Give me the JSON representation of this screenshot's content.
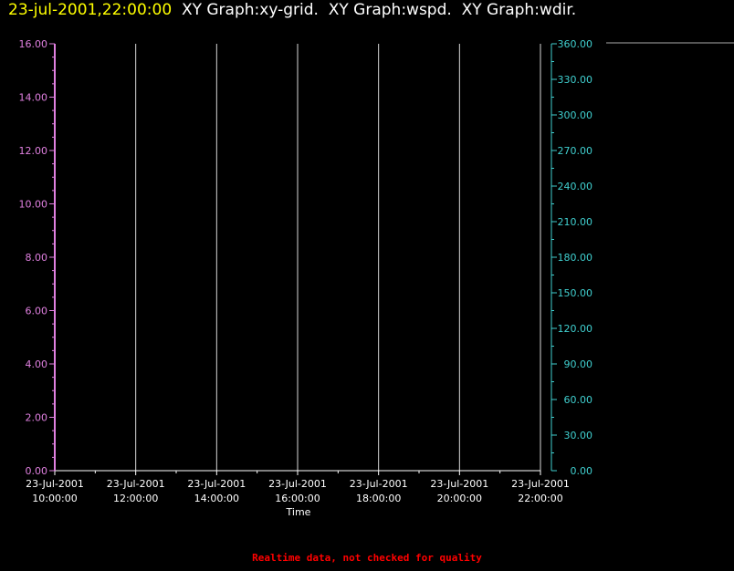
{
  "header": {
    "timestamp": "23-jul-2001,22:00:00",
    "graph_titles": [
      "XY Graph:xy-grid.",
      "XY Graph:wspd.",
      "XY Graph:wdir."
    ]
  },
  "colors": {
    "background": "#000000",
    "timestamp": "#ffff00",
    "titles": "#ffffff",
    "left_axis": "#e080e0",
    "right_axis": "#40d0d0",
    "grid": "#ffffff",
    "footer": "#ff0000"
  },
  "chart_data": {
    "type": "line",
    "grid": true,
    "xlabel": "Time",
    "x_ticks": [
      {
        "date": "23-Jul-2001",
        "time": "10:00:00"
      },
      {
        "date": "23-Jul-2001",
        "time": "12:00:00"
      },
      {
        "date": "23-Jul-2001",
        "time": "14:00:00"
      },
      {
        "date": "23-Jul-2001",
        "time": "16:00:00"
      },
      {
        "date": "23-Jul-2001",
        "time": "18:00:00"
      },
      {
        "date": "23-Jul-2001",
        "time": "20:00:00"
      },
      {
        "date": "23-Jul-2001",
        "time": "22:00:00"
      }
    ],
    "xlim": [
      "23-Jul-2001 10:00:00",
      "23-Jul-2001 22:00:00"
    ],
    "left_axis": {
      "ylim": [
        0,
        16
      ],
      "tick_labels": [
        "0.00",
        "2.00",
        "4.00",
        "6.00",
        "8.00",
        "10.00",
        "12.00",
        "14.00",
        "16.00"
      ]
    },
    "right_axis": {
      "ylim": [
        0,
        360
      ],
      "tick_labels": [
        "0.00",
        "30.00",
        "60.00",
        "90.00",
        "120.00",
        "150.00",
        "180.00",
        "210.00",
        "240.00",
        "270.00",
        "300.00",
        "330.00",
        "360.00"
      ]
    },
    "series": []
  },
  "footer": "Realtime data, not checked for quality"
}
